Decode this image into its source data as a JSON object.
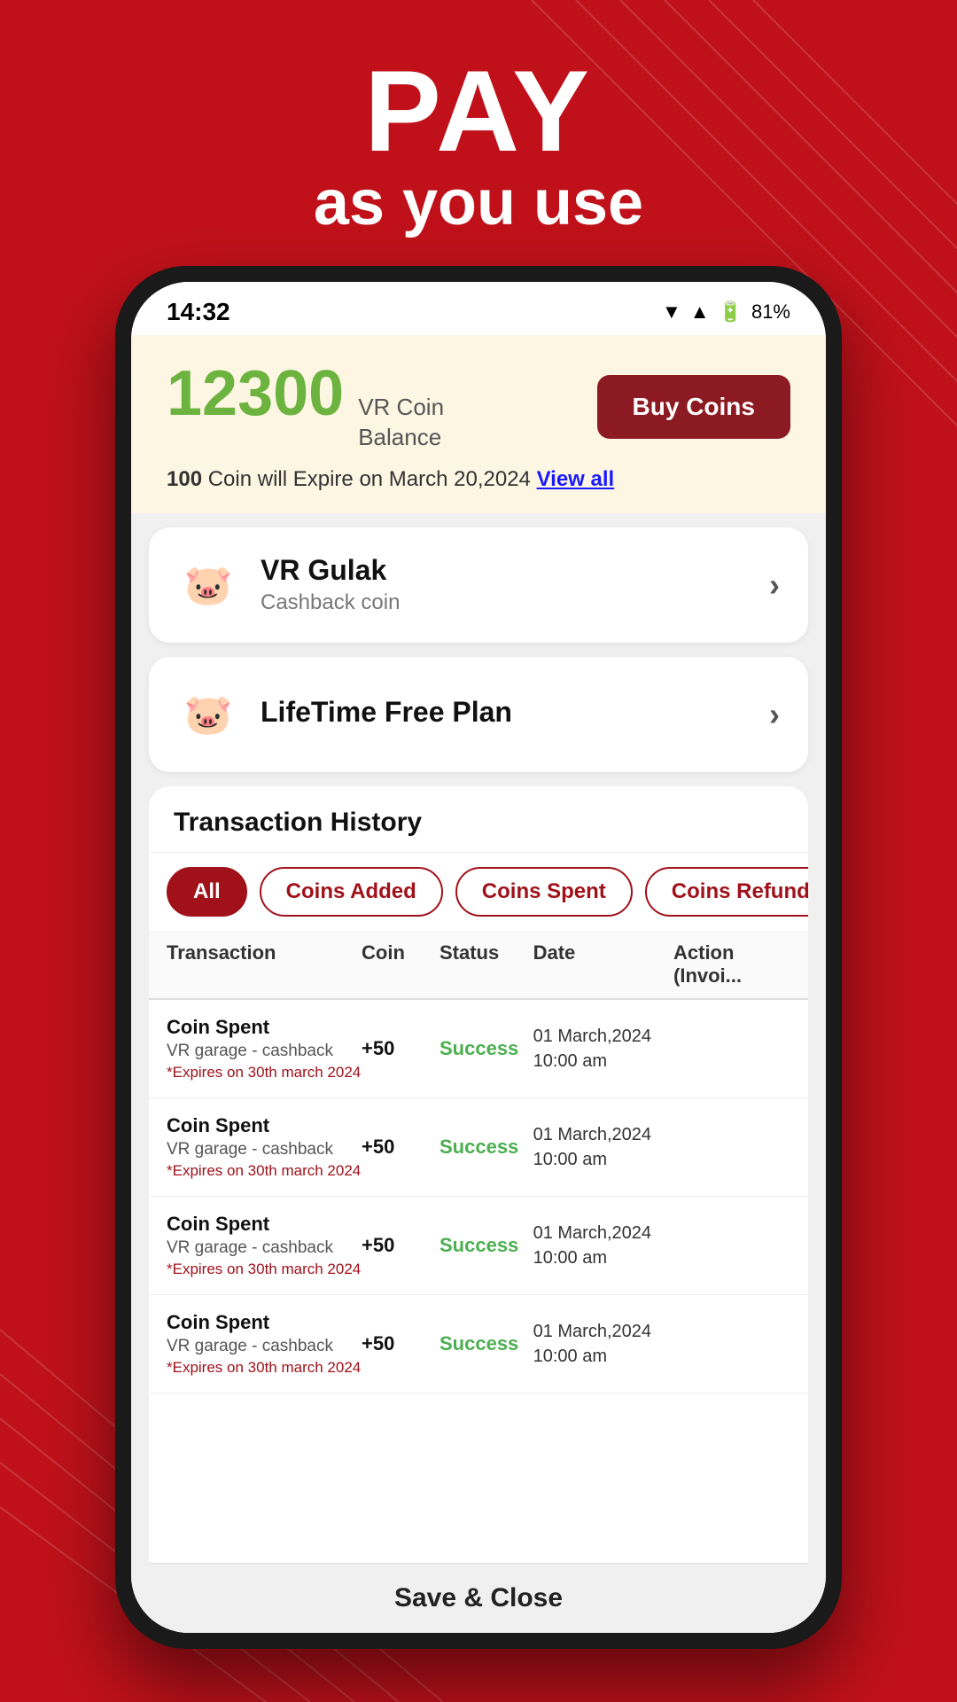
{
  "background": {
    "color": "#c0111a"
  },
  "hero": {
    "pay_label": "PAY",
    "subtitle": "as you use"
  },
  "status_bar": {
    "time": "14:32",
    "battery": "81%"
  },
  "coin_balance": {
    "balance_number": "12300",
    "balance_label_line1": "VR Coin",
    "balance_label_line2": "Balance",
    "buy_btn_label": "Buy Coins",
    "expire_prefix": "100",
    "expire_text": " Coin will Expire on March 20,2024 ",
    "view_all_label": "View all"
  },
  "gulak_card": {
    "title": "VR Gulak",
    "subtitle": "Cashback coin"
  },
  "free_plan_card": {
    "title_prefix": "LifeTime ",
    "title_bold": "Free",
    "title_suffix": " Plan"
  },
  "transaction_history": {
    "section_title": "Transaction History",
    "filters": [
      {
        "label": "All",
        "active": true
      },
      {
        "label": "Coins Added",
        "active": false
      },
      {
        "label": "Coins Spent",
        "active": false
      },
      {
        "label": "Coins Refunded",
        "active": false
      }
    ],
    "table_headers": [
      "Transaction",
      "Coin",
      "Status",
      "Date",
      "Action\n(Invoi..."
    ],
    "rows": [
      {
        "name": "Coin Spent",
        "sub": "VR garage - cashback",
        "expires": "*Expires on 30th march 2024",
        "coin": "+50",
        "status": "Success",
        "date": "01 March,2024\n10:00 am",
        "action": ""
      },
      {
        "name": "Coin Spent",
        "sub": "VR garage - cashback",
        "expires": "*Expires on 30th march 2024",
        "coin": "+50",
        "status": "Success",
        "date": "01 March,2024\n10:00 am",
        "action": ""
      },
      {
        "name": "Coin Spent",
        "sub": "VR garage - cashback",
        "expires": "*Expires on 30th march 2024",
        "coin": "+50",
        "status": "Success",
        "date": "01 March,2024\n10:00 am",
        "action": ""
      },
      {
        "name": "Coin Spent",
        "sub": "VR garage - cashback",
        "expires": "*Expires on 30th march 2024",
        "coin": "+50",
        "status": "Success",
        "date": "01 March,2024\n10:00 am",
        "action": ""
      }
    ]
  },
  "save_close": {
    "label": "Save & Close"
  }
}
